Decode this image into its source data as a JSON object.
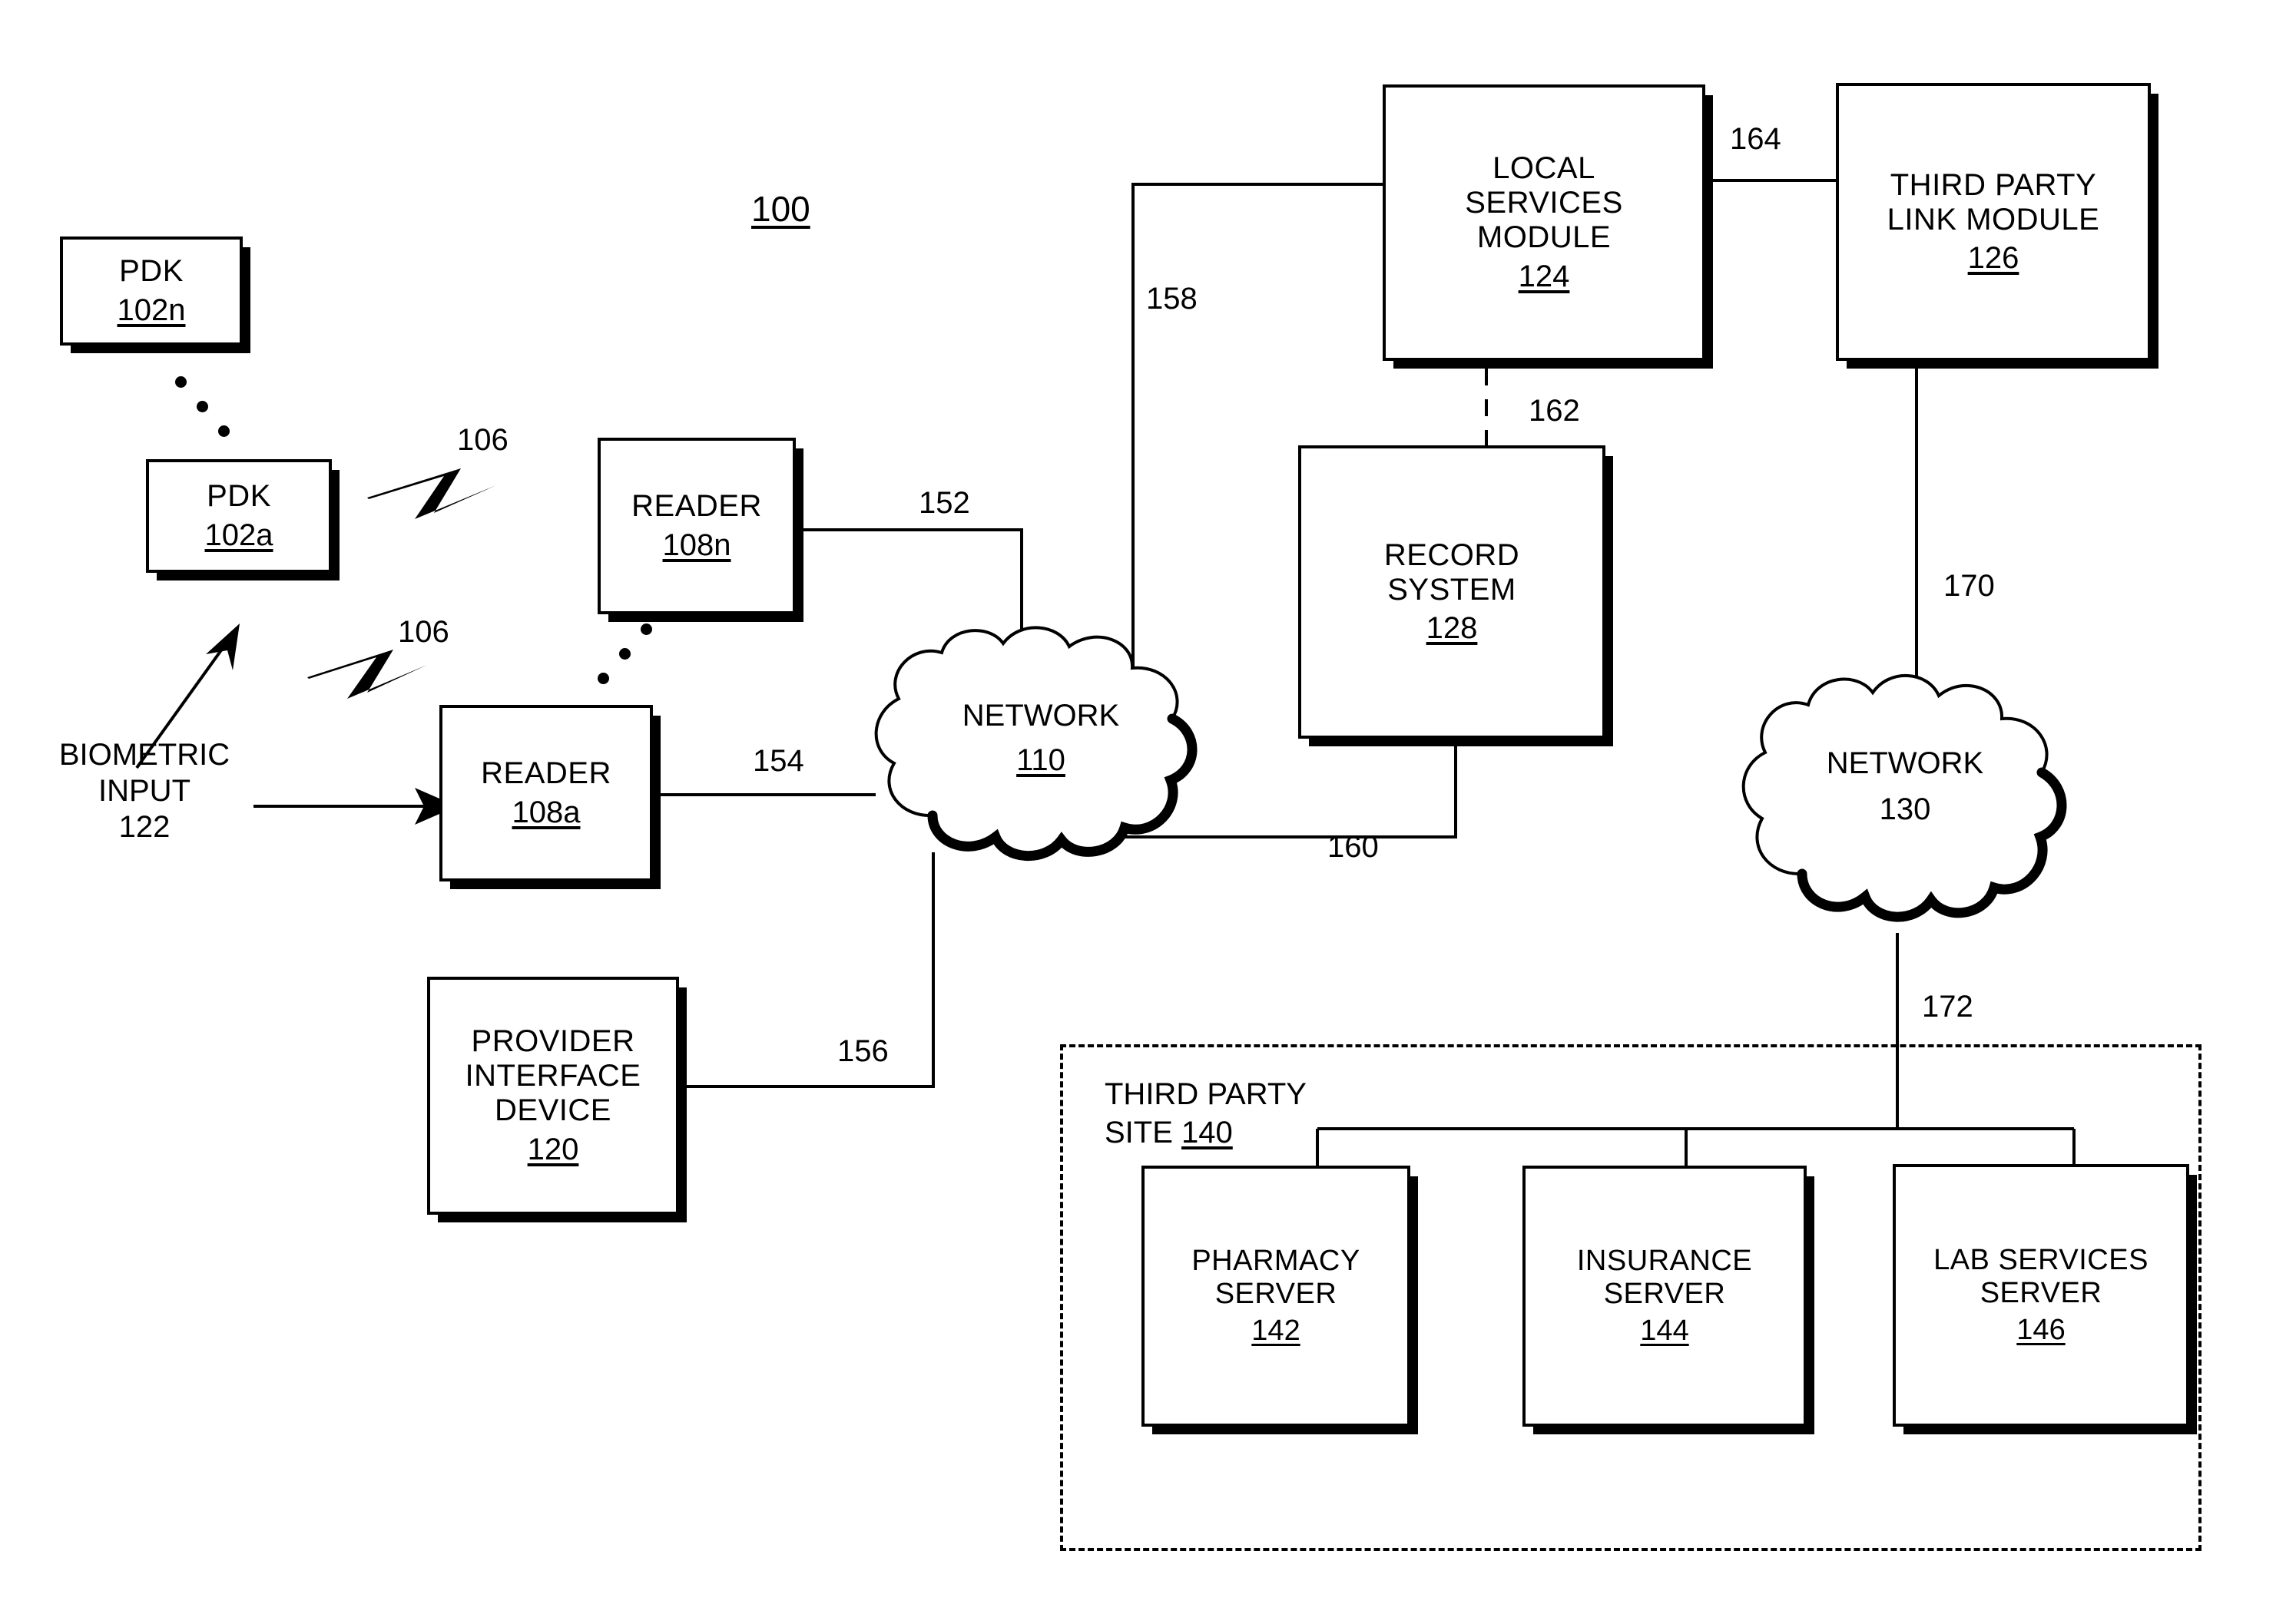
{
  "figure": {
    "number": "100",
    "type": "patent-block-diagram"
  },
  "nodes": {
    "pdk_n": {
      "title": "PDK",
      "ref": "102n"
    },
    "pdk_a": {
      "title": "PDK",
      "ref": "102a"
    },
    "reader_n": {
      "title": "READER",
      "ref": "108n"
    },
    "reader_a": {
      "title": "READER",
      "ref": "108a"
    },
    "provider_interface_device": {
      "line1": "PROVIDER",
      "line2": "INTERFACE",
      "line3": "DEVICE",
      "ref": "120"
    },
    "local_services_module": {
      "line1": "LOCAL",
      "line2": "SERVICES",
      "line3": "MODULE",
      "ref": "124"
    },
    "third_party_link_module": {
      "line1": "THIRD PARTY",
      "line2": "LINK MODULE",
      "ref": "126"
    },
    "record_system": {
      "line1": "RECORD",
      "line2": "SYSTEM",
      "ref": "128"
    },
    "pharmacy_server": {
      "line1": "PHARMACY",
      "line2": "SERVER",
      "ref": "142"
    },
    "insurance_server": {
      "line1": "INSURANCE",
      "line2": "SERVER",
      "ref": "144"
    },
    "lab_services_server": {
      "line1": "LAB SERVICES",
      "line2": "SERVER",
      "ref": "146"
    }
  },
  "clouds": {
    "network_110": {
      "title": "NETWORK",
      "ref": "110"
    },
    "network_130": {
      "title": "NETWORK",
      "ref": "130"
    }
  },
  "groups": {
    "third_party_site": {
      "line1": "THIRD PARTY",
      "line2_prefix": "SITE ",
      "ref": "140"
    }
  },
  "annotations": {
    "biometric_input": {
      "line1": "BIOMETRIC",
      "line2": "INPUT",
      "ref": "122"
    },
    "wireless_1": "106",
    "wireless_2": "106",
    "link_152": "152",
    "link_154": "154",
    "link_156": "156",
    "link_158": "158",
    "link_160": "160",
    "link_162": "162",
    "link_164": "164",
    "link_170": "170",
    "link_172": "172"
  },
  "colors": {
    "stroke": "#000000",
    "background": "#ffffff"
  }
}
